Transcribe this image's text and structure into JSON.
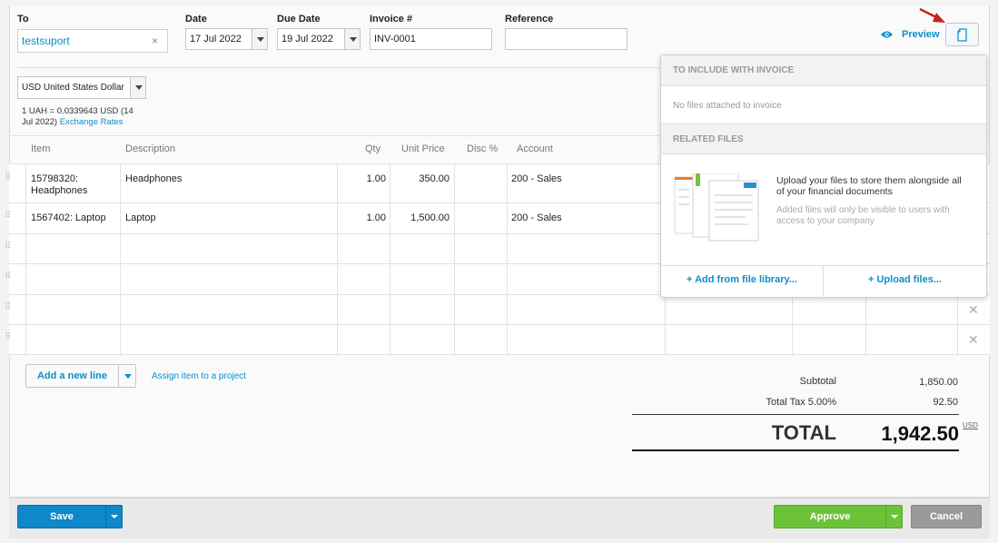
{
  "header": {
    "to_label": "To",
    "to_value": "testsuport",
    "date_label": "Date",
    "date_value": "17 Jul 2022",
    "due_label": "Due Date",
    "due_value": "19 Jul 2022",
    "invoice_label": "Invoice #",
    "invoice_value": "INV-0001",
    "reference_label": "Reference",
    "reference_value": "",
    "preview": "Preview"
  },
  "currency": {
    "selected": "USD United States Dollar",
    "rate_line1": "1 UAH = 0.0339643 USD (14",
    "rate_line2": "Jul 2022)",
    "exchange_link": "Exchange Rates"
  },
  "table": {
    "columns": [
      "Item",
      "Description",
      "Qty",
      "Unit Price",
      "Disc %",
      "Account"
    ],
    "rows": [
      {
        "item": "15798320: Headphones",
        "description": "Headphones",
        "qty": "1.00",
        "price": "350.00",
        "disc": "",
        "account": "200 - Sales"
      },
      {
        "item": "1567402: Laptop",
        "description": "Laptop",
        "qty": "1.00",
        "price": "1,500.00",
        "disc": "",
        "account": "200 - Sales"
      }
    ]
  },
  "actions": {
    "add_line": "Add a new line",
    "assign_project": "Assign item to a project",
    "save": "Save",
    "approve": "Approve",
    "cancel": "Cancel"
  },
  "totals": {
    "subtotal_label": "Subtotal",
    "subtotal_value": "1,850.00",
    "tax_label": "Total Tax 5.00%",
    "tax_value": "92.50",
    "total_label": "TOTAL",
    "total_value": "1,942.50",
    "currency": "USD"
  },
  "files_panel": {
    "include_header": "TO INCLUDE WITH INVOICE",
    "no_files": "No files attached to invoice",
    "related_header": "RELATED FILES",
    "upload_title": "Upload your files to store them alongside all of your financial documents",
    "upload_note": "Added files will only be visible to users with access to your company",
    "add_library": "+ Add from file library...",
    "upload_files": "+ Upload files..."
  },
  "colors": {
    "accent": "#0b8fc9",
    "save": "#0f87c9",
    "approve": "#6cc33a",
    "cancel": "#9a9a9a"
  }
}
